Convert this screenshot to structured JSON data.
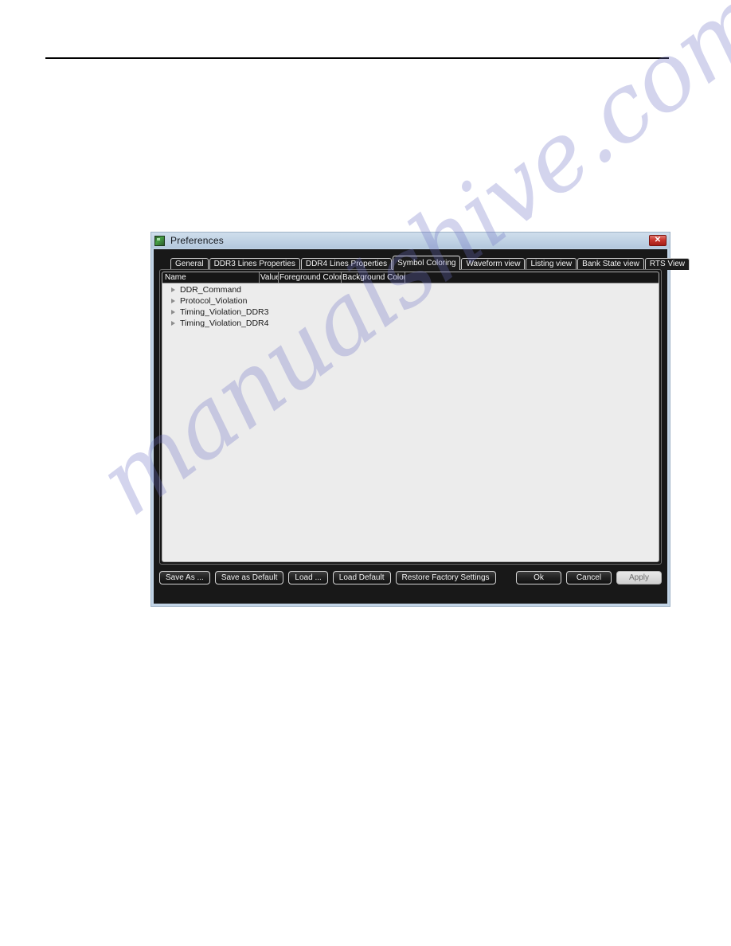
{
  "window": {
    "title": "Preferences",
    "icon": "app-icon",
    "close_label": "✕",
    "accent_titlebar": "#c0d2e4",
    "accent_close": "#c9352c"
  },
  "tabs": [
    {
      "label": "General",
      "active": false
    },
    {
      "label": "DDR3 Lines Properties",
      "active": false
    },
    {
      "label": "DDR4 Lines Properties",
      "active": false
    },
    {
      "label": "Symbol Coloring",
      "active": true
    },
    {
      "label": "Waveform view",
      "active": false
    },
    {
      "label": "Listing view",
      "active": false
    },
    {
      "label": "Bank State view",
      "active": false
    },
    {
      "label": "RTS View",
      "active": false
    }
  ],
  "tree": {
    "columns": [
      {
        "label": "Name"
      },
      {
        "label": "Value"
      },
      {
        "label": "Foreground Color"
      },
      {
        "label": "Background Color"
      },
      {
        "label": ""
      }
    ],
    "rows": [
      {
        "label": "DDR_Command",
        "expanded": false
      },
      {
        "label": "Protocol_Violation",
        "expanded": false
      },
      {
        "label": "Timing_Violation_DDR3",
        "expanded": false
      },
      {
        "label": "Timing_Violation_DDR4",
        "expanded": false
      }
    ]
  },
  "buttons": {
    "save_as": "Save As ...",
    "save_as_default": "Save as Default",
    "load": "Load ...",
    "load_default": "Load Default",
    "restore_factory": "Restore Factory Settings",
    "ok": "Ok",
    "cancel": "Cancel",
    "apply": "Apply"
  },
  "watermark": {
    "text": "manualshive.com"
  }
}
